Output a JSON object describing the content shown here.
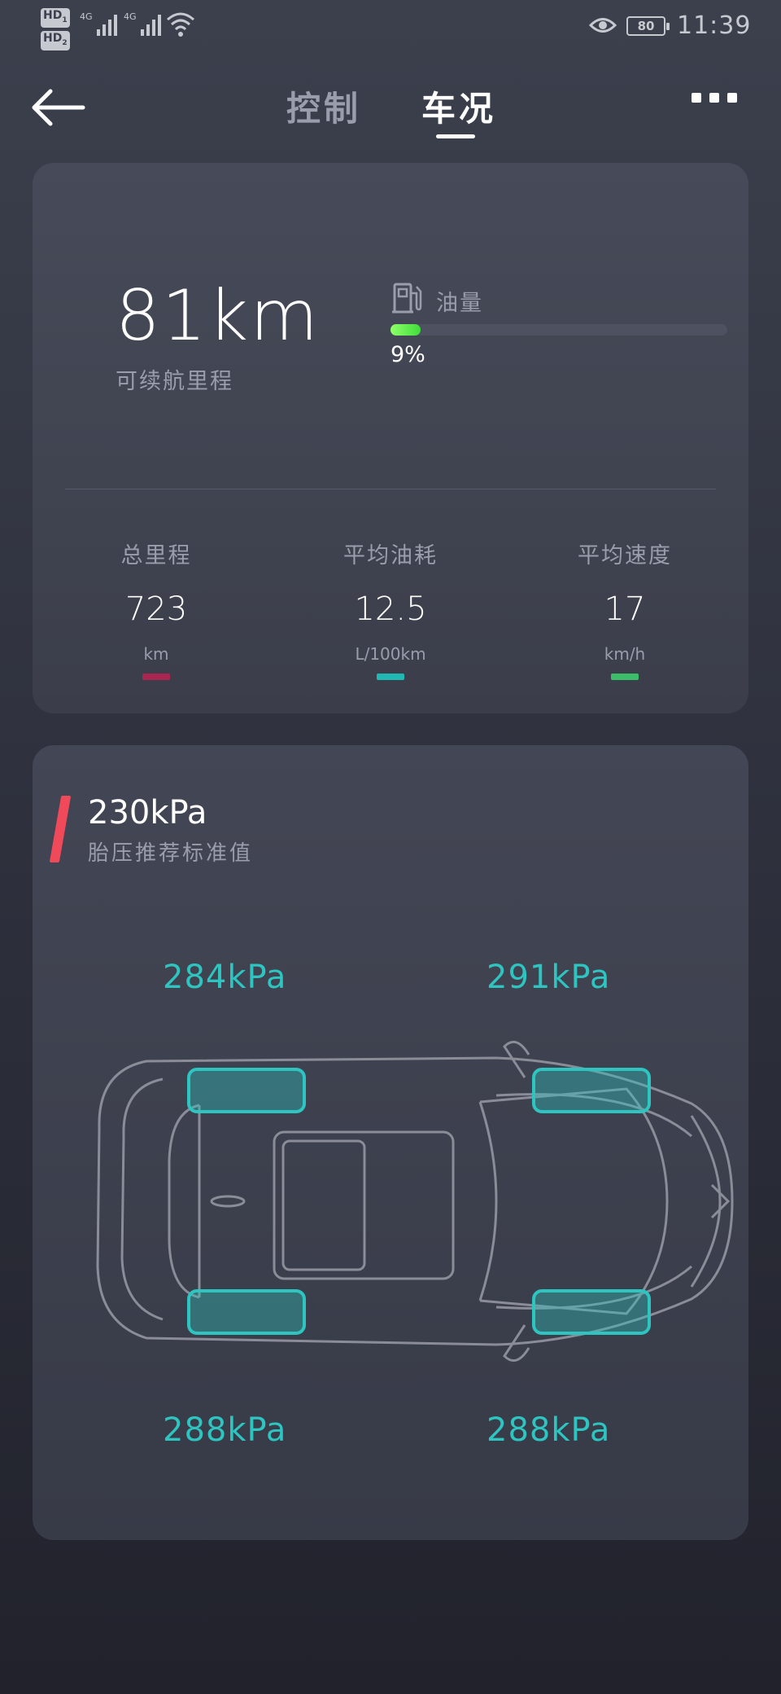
{
  "status_bar": {
    "hd1": "HD",
    "hd1_sub": "1",
    "hd2": "HD",
    "hd2_sub": "2",
    "network1": "4G",
    "network2": "4G",
    "battery": "80",
    "time": "11:39"
  },
  "header": {
    "tabs": [
      {
        "label": "控制",
        "active": false
      },
      {
        "label": "车况",
        "active": true
      }
    ]
  },
  "overview": {
    "range_value": "81km",
    "range_label": "可续航里程",
    "fuel_label": "油量",
    "fuel_percent_text": "9%",
    "fuel_level": 0.09,
    "stats": [
      {
        "label": "总里程",
        "value": "723",
        "unit": "km",
        "color": "#a8264f"
      },
      {
        "label": "平均油耗",
        "value": "12.5",
        "unit": "L/100km",
        "color": "#21b8b3"
      },
      {
        "label": "平均速度",
        "value": "17",
        "unit": "km/h",
        "color": "#3bbd6a"
      }
    ]
  },
  "tires": {
    "recommended_value": "230kPa",
    "recommended_label": "胎压推荐标准值",
    "front_left": "284kPa",
    "front_right": "291kPa",
    "rear_left": "288kPa",
    "rear_right": "288kPa",
    "tire_color": "#2ec4c0"
  },
  "colors": {
    "accent_red": "#f04a5a",
    "fuel_green": "#5fe84a"
  }
}
